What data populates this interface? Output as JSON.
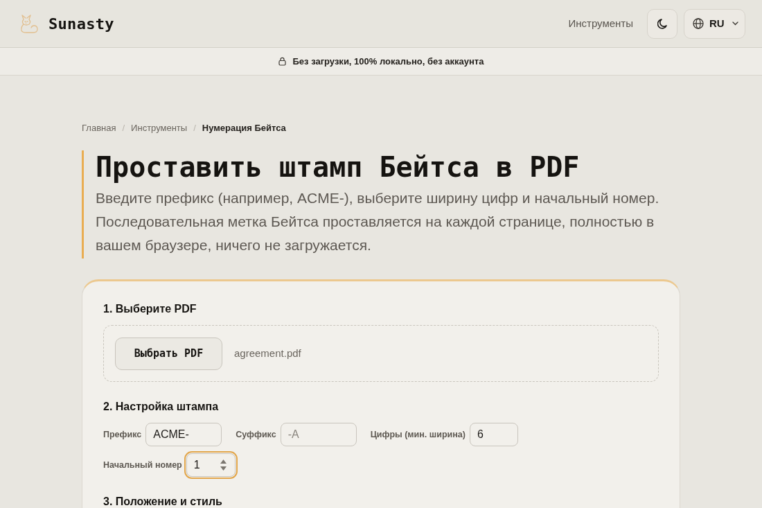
{
  "header": {
    "logo": "Sunasty",
    "nav": [
      {
        "label": "Инструменты"
      }
    ],
    "language": "RU"
  },
  "banner": {
    "text": "Без загрузки, 100% локально, без аккаунта"
  },
  "breadcrumb": [
    {
      "label": "Главная",
      "current": false
    },
    {
      "label": "Инструменты",
      "current": false
    },
    {
      "label": "Нумерация Бейтса",
      "current": true
    }
  ],
  "breadcrumb_separators": [
    "/",
    "/"
  ],
  "title": "Проставить штамп Бейтса в PDF",
  "description": "Введите префикс (например, ACME-), выберите ширину цифр и начальный номер. Последовательная метка Бейтса проставляется на каждой странице, полностью в вашем браузере, ничего не загружается.",
  "steps": [
    {
      "kind": "file",
      "heading": "1. Выберите PDF",
      "button": "Выбрать PDF",
      "file_name": "agreement.pdf"
    },
    {
      "kind": "fields",
      "heading": "2. Настройка штампа",
      "fields": [
        {
          "kind": "text",
          "label": "Префикс",
          "value": "ACME-",
          "focused": false
        },
        {
          "kind": "text",
          "label": "Суффикс",
          "placeholder": "-A",
          "focused": false
        },
        {
          "kind": "text",
          "label": "Цифры (мин. ширина)",
          "value": "6",
          "focused": false
        },
        {
          "kind": "number",
          "label": "Начальный номер",
          "value": "1",
          "focused": true
        }
      ]
    },
    {
      "kind": "heading",
      "heading": "3. Положение и стиль"
    }
  ]
}
